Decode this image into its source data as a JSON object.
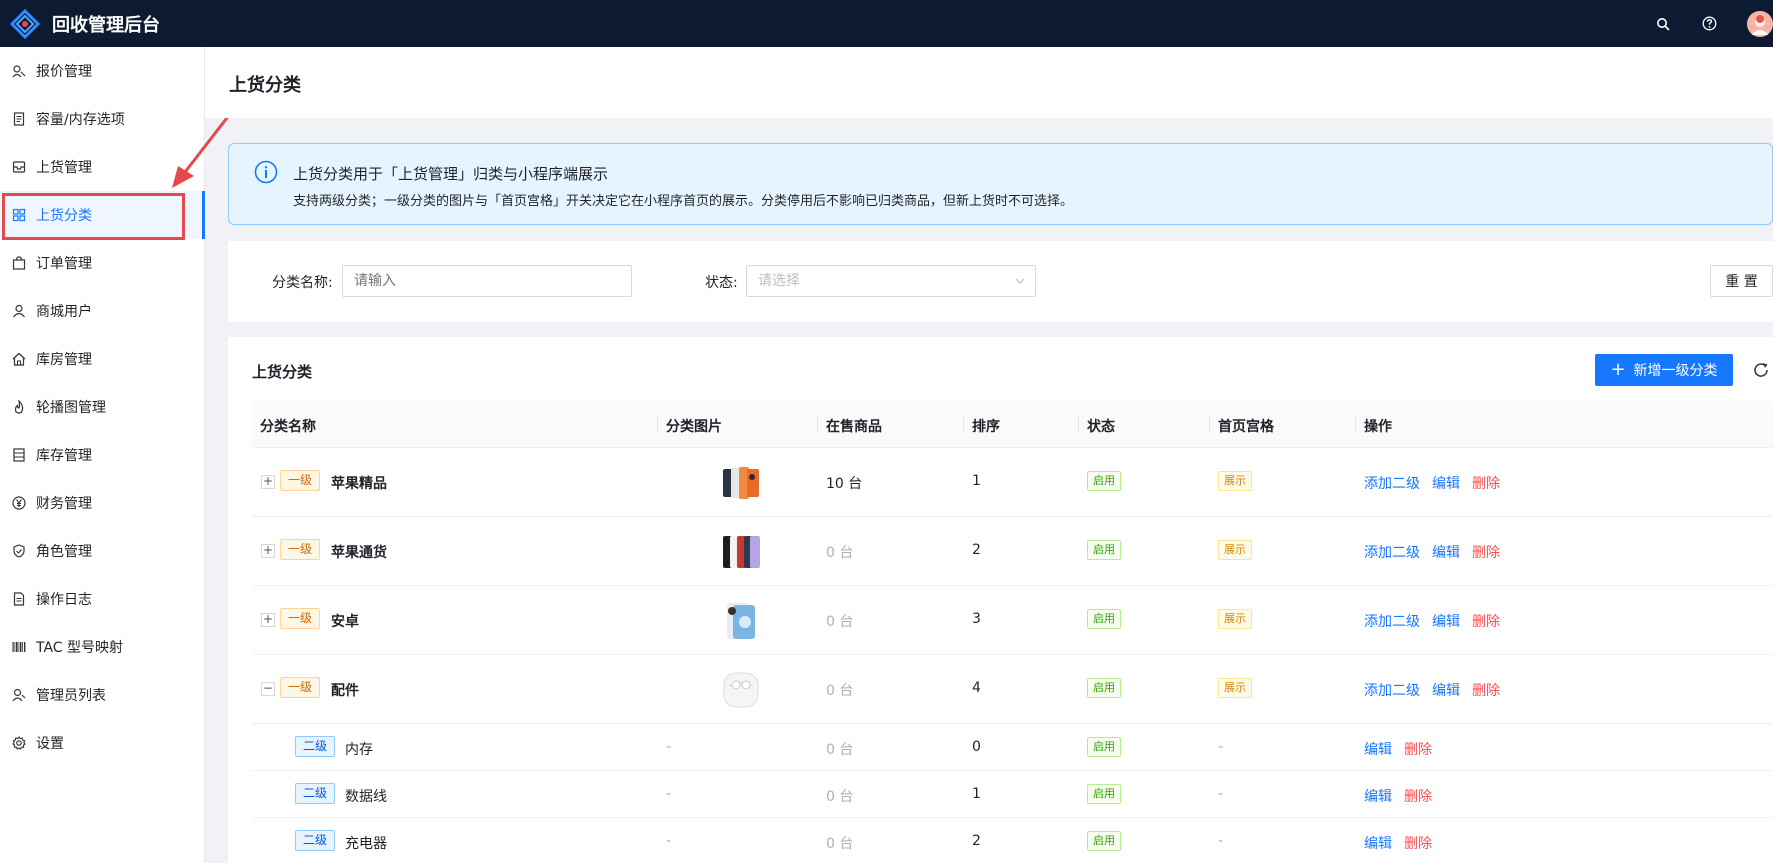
{
  "header": {
    "app_title": "回收管理后台",
    "search_icon": "search-icon",
    "help_icon": "help-icon",
    "avatar_icon": "avatar"
  },
  "sidebar": {
    "items": [
      {
        "label": "报价管理",
        "icon": "quote-icon"
      },
      {
        "label": "容量/内存选项",
        "icon": "memory-icon"
      },
      {
        "label": "上货管理",
        "icon": "inbox-icon"
      },
      {
        "label": "上货分类",
        "icon": "category-icon",
        "active": true
      },
      {
        "label": "订单管理",
        "icon": "bag-icon"
      },
      {
        "label": "商城用户",
        "icon": "user-icon"
      },
      {
        "label": "库房管理",
        "icon": "home-icon"
      },
      {
        "label": "轮播图管理",
        "icon": "fire-icon"
      },
      {
        "label": "库存管理",
        "icon": "stock-icon"
      },
      {
        "label": "财务管理",
        "icon": "yen-icon"
      },
      {
        "label": "角色管理",
        "icon": "shield-icon"
      },
      {
        "label": "操作日志",
        "icon": "log-icon"
      },
      {
        "label": "TAC 型号映射",
        "icon": "barcode-icon"
      },
      {
        "label": "管理员列表",
        "icon": "admin-icon"
      },
      {
        "label": "设置",
        "icon": "gear-icon"
      }
    ]
  },
  "page": {
    "title": "上货分类"
  },
  "alert": {
    "title": "上货分类用于「上货管理」归类与小程序端展示",
    "description": "支持两级分类；一级分类的图片与「首页宫格」开关决定它在小程序首页的展示。分类停用后不影响已归类商品，但新上货时不可选择。"
  },
  "filter": {
    "name_label": "分类名称:",
    "name_placeholder": "请输入",
    "status_label": "状态:",
    "status_placeholder": "请选择",
    "reset_label": "重 置"
  },
  "table_card": {
    "title": "上货分类",
    "add_label": "新增一级分类",
    "columns": [
      "分类名称",
      "分类图片",
      "在售商品",
      "排序",
      "状态",
      "首页宫格",
      "操作"
    ],
    "rows": [
      {
        "level_tag": "一级",
        "expand": "+",
        "name": "苹果精品",
        "image": "iphone-pro-image",
        "on_sale": "10 台",
        "sort": "1",
        "status": "启用",
        "grid": "展示",
        "actions": [
          "添加二级",
          "编辑",
          "删除"
        ]
      },
      {
        "level_tag": "一级",
        "expand": "+",
        "name": "苹果通货",
        "image": "iphone-image",
        "on_sale": "0 台",
        "sort": "2",
        "status": "启用",
        "grid": "展示",
        "actions": [
          "添加二级",
          "编辑",
          "删除"
        ]
      },
      {
        "level_tag": "一级",
        "expand": "+",
        "name": "安卓",
        "image": "android-image",
        "on_sale": "0 台",
        "sort": "3",
        "status": "启用",
        "grid": "展示",
        "actions": [
          "添加二级",
          "编辑",
          "删除"
        ]
      },
      {
        "level_tag": "一级",
        "expand": "−",
        "name": "配件",
        "image": "airpods-image",
        "on_sale": "0 台",
        "sort": "4",
        "status": "启用",
        "grid": "展示",
        "actions": [
          "添加二级",
          "编辑",
          "删除"
        ]
      }
    ],
    "sub_rows": [
      {
        "level_tag": "二级",
        "name": "内存",
        "image": "-",
        "on_sale": "0 台",
        "sort": "0",
        "status": "启用",
        "grid": "-",
        "actions": [
          "编辑",
          "删除"
        ]
      },
      {
        "level_tag": "二级",
        "name": "数据线",
        "image": "-",
        "on_sale": "0 台",
        "sort": "1",
        "status": "启用",
        "grid": "-",
        "actions": [
          "编辑",
          "删除"
        ]
      },
      {
        "level_tag": "二级",
        "name": "充电器",
        "image": "-",
        "on_sale": "0 台",
        "sort": "2",
        "status": "启用",
        "grid": "-",
        "actions": [
          "编辑",
          "删除"
        ]
      }
    ]
  },
  "colors": {
    "primary": "#1677ff",
    "header_bg": "#0c1b31",
    "danger": "#ff4d4f",
    "annotation_red": "#e5484d"
  }
}
